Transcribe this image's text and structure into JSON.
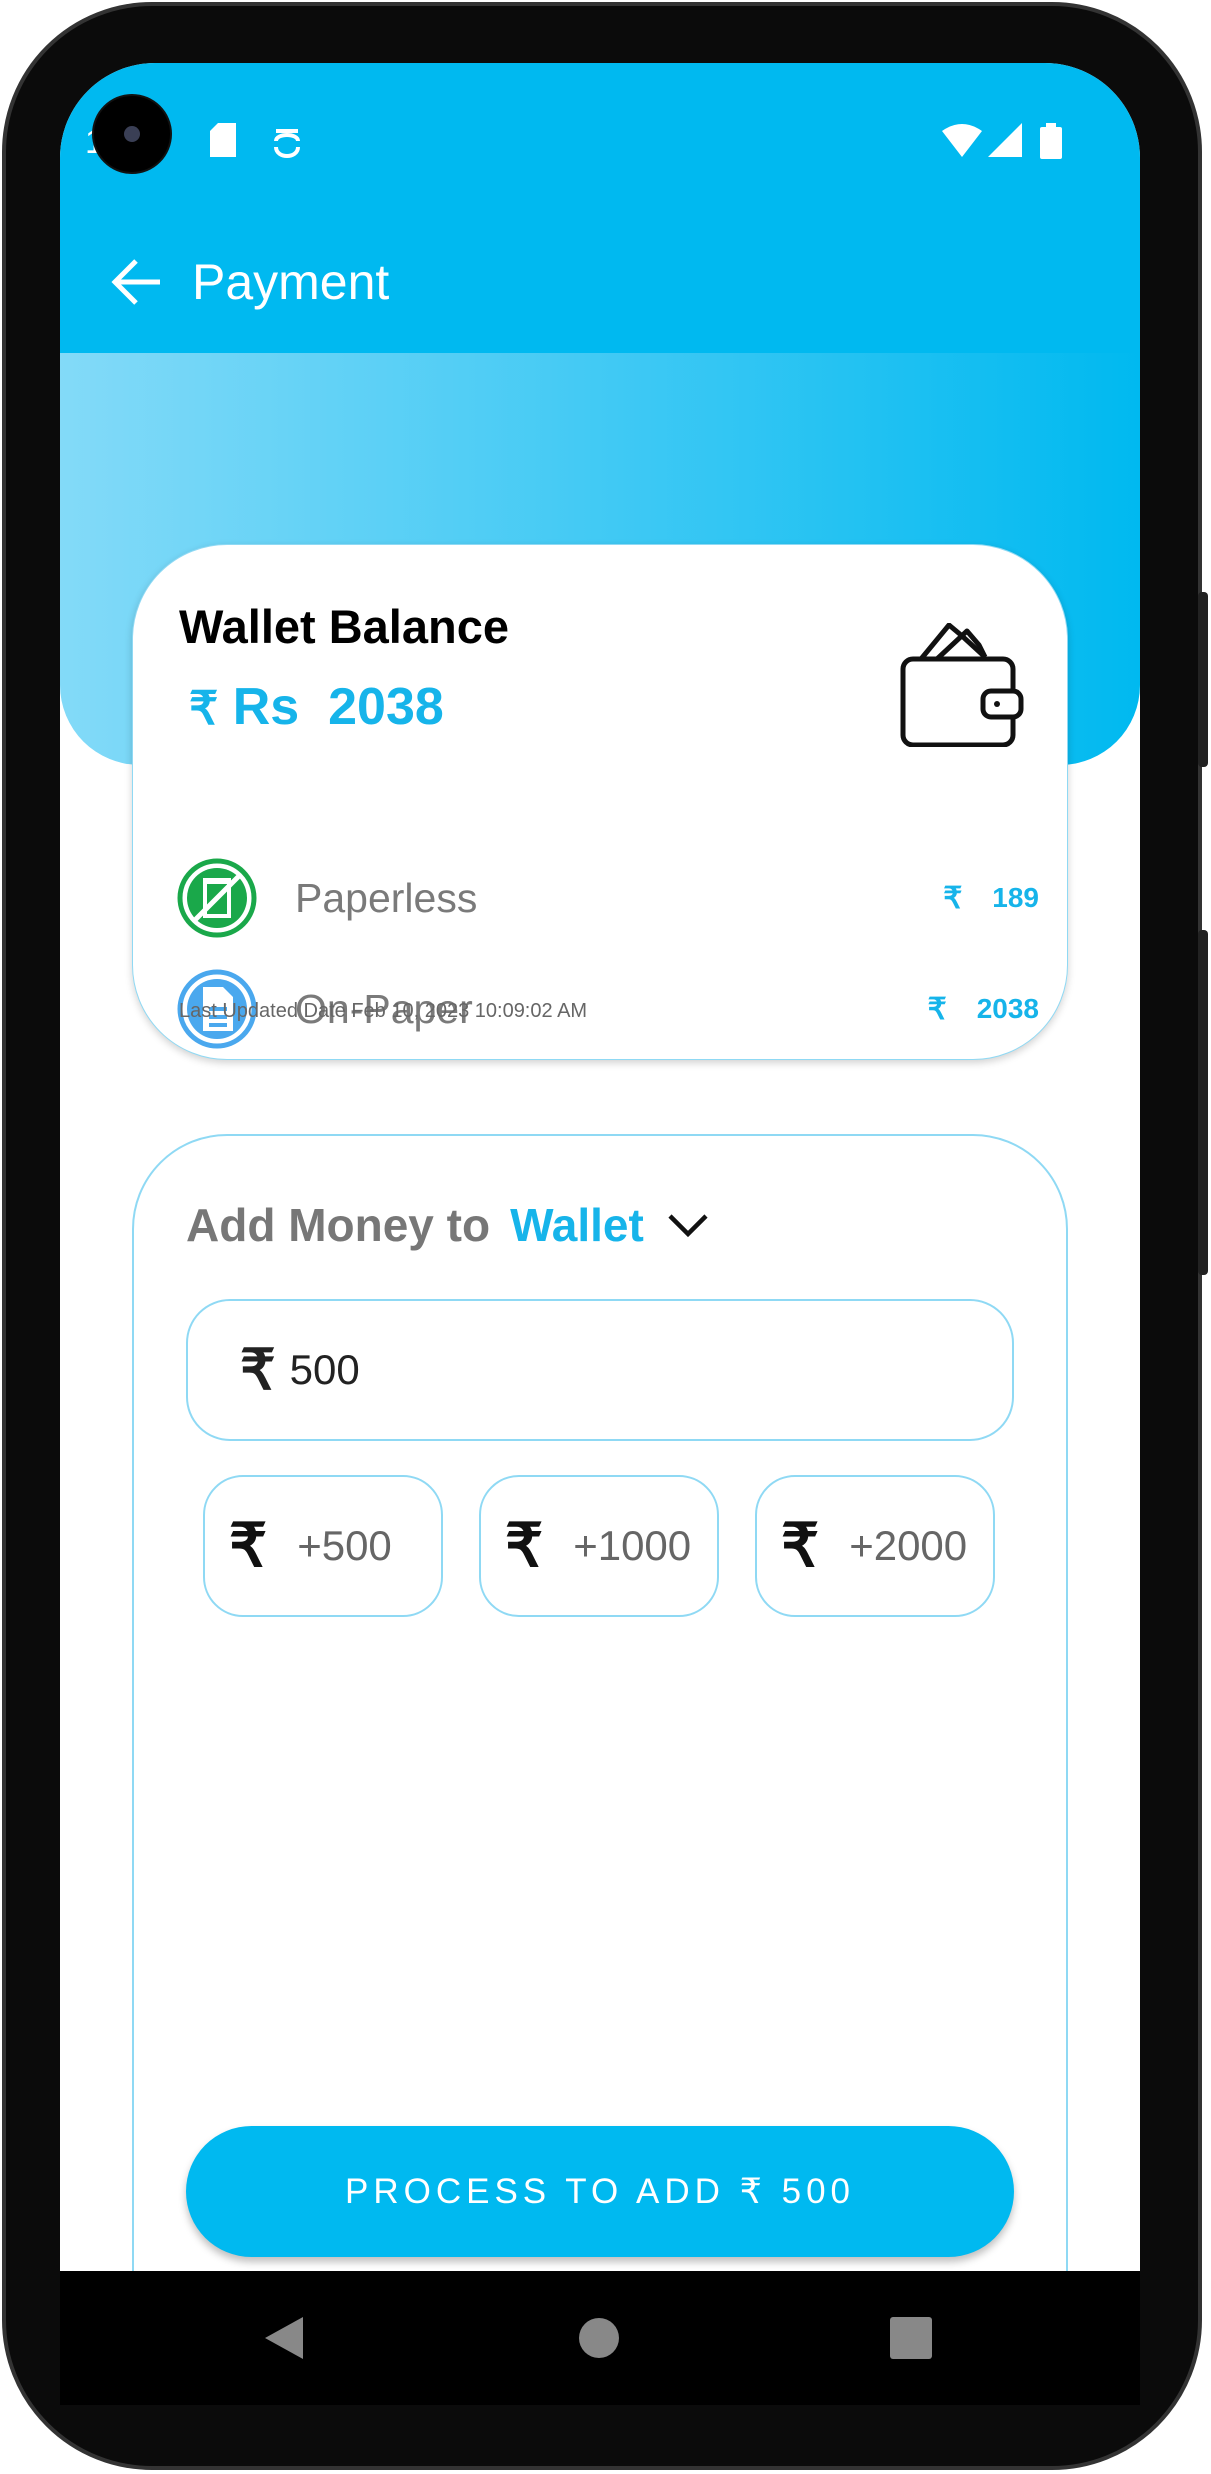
{
  "status_bar": {
    "time": "10:09",
    "icons": [
      "sd-card-icon",
      "alert-icon",
      "wifi-icon",
      "signal-icon",
      "battery-icon"
    ]
  },
  "app_bar": {
    "title": "Payment",
    "back_icon": "arrow-left-icon"
  },
  "wallet_card": {
    "title": "Wallet Balance",
    "currency_symbol": "₹",
    "balance_label": "Rs",
    "balance": "2038",
    "rows": [
      {
        "label": "Paperless",
        "symbol": "₹",
        "amount": "189",
        "icon": "paperless-icon",
        "color": "#1aa84a"
      },
      {
        "label": "On-Paper",
        "symbol": "₹",
        "amount": "2038",
        "icon": "document-icon",
        "color": "#4aa8ee"
      }
    ],
    "last_updated": "Last Updated Date Feb 10, 2023 10:09:02 AM"
  },
  "add_money": {
    "label": "Add Money to",
    "target": "Wallet",
    "amount_symbol": "₹",
    "amount_value": "500",
    "chips": [
      {
        "symbol": "₹",
        "label": "+500"
      },
      {
        "symbol": "₹",
        "label": "+1000"
      },
      {
        "symbol": "₹",
        "label": "+2000"
      }
    ],
    "submit_label": "PROCESS TO ADD ₹ 500"
  },
  "colors": {
    "primary": "#00b9f0",
    "accent_text": "#16b4ea"
  }
}
